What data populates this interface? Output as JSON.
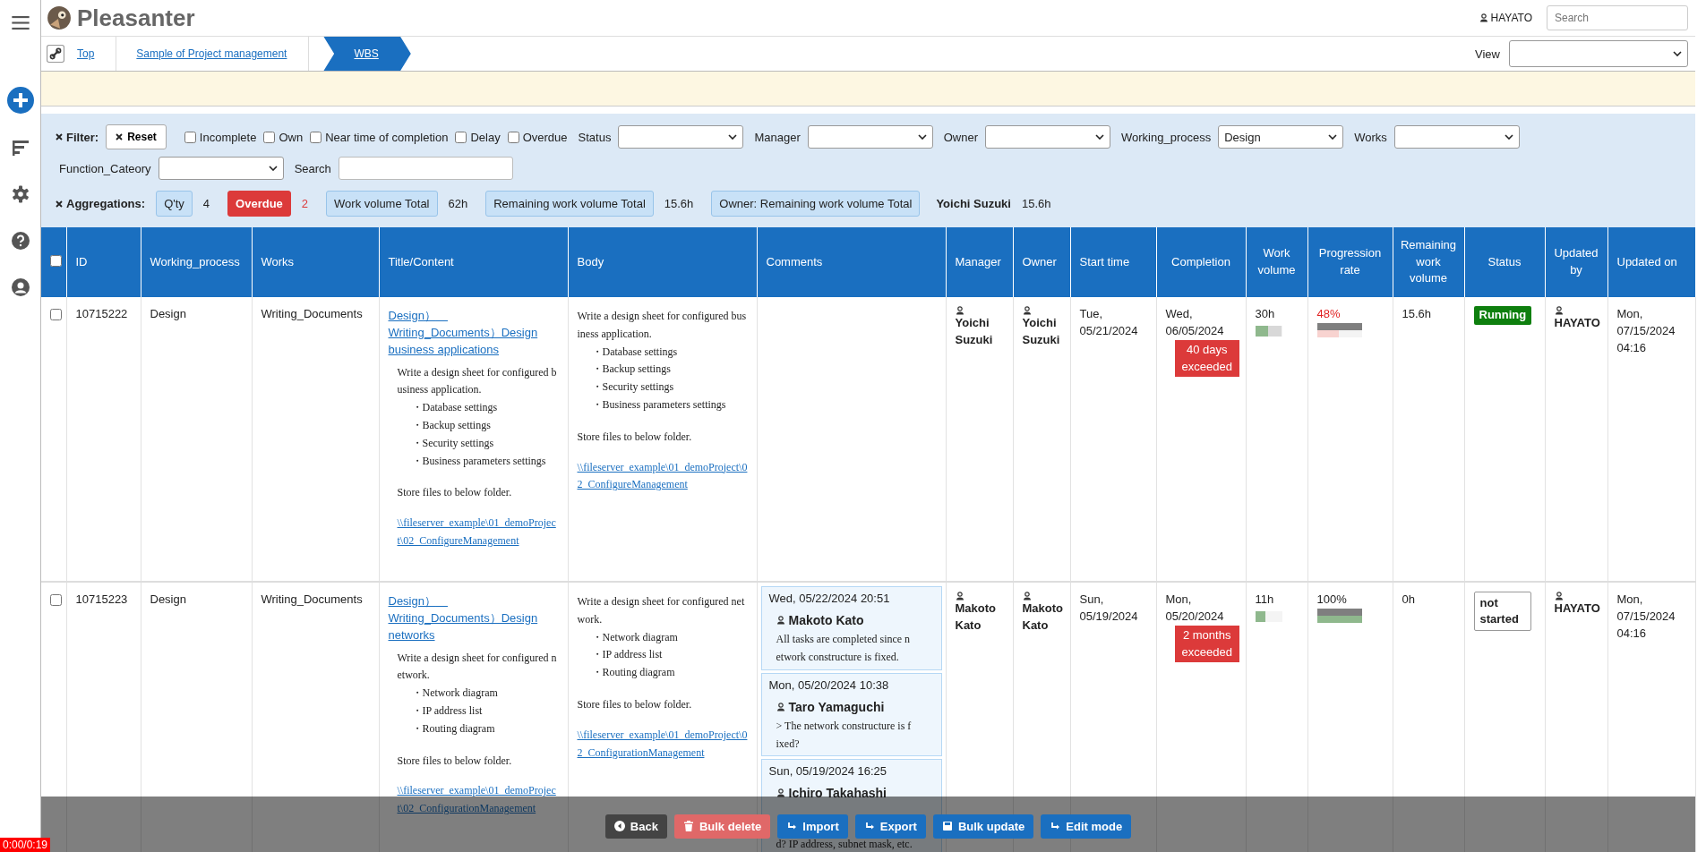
{
  "header": {
    "app_name": "Pleasanter",
    "user": "HAYATO",
    "search": {
      "placeholder": "Search"
    }
  },
  "breadcrumb": [
    {
      "label": "Top",
      "selected": false
    },
    {
      "label": "Sample of Project management",
      "selected": false
    },
    {
      "label": "WBS",
      "selected": true
    }
  ],
  "view": {
    "label": "View"
  },
  "filter": {
    "label": "Filter:",
    "reset": "Reset",
    "checkboxes": [
      {
        "label": "Incomplete",
        "checked": false
      },
      {
        "label": "Own",
        "checked": false
      },
      {
        "label": "Near time of completion",
        "checked": false
      },
      {
        "label": "Delay",
        "checked": false
      },
      {
        "label": "Overdue",
        "checked": false
      }
    ],
    "dropdowns": [
      {
        "label": "Status"
      },
      {
        "label": "Manager"
      },
      {
        "label": "Owner"
      },
      {
        "label": "Working_process",
        "value": "Design"
      },
      {
        "label": "Works"
      },
      {
        "label": "Function_Cateory"
      }
    ],
    "search_label": "Search"
  },
  "aggregations": {
    "label": "Aggregations:",
    "items": [
      {
        "kind": "chip",
        "label": "Q'ty",
        "value": "4"
      },
      {
        "kind": "alert",
        "label": "Overdue",
        "value": "2"
      },
      {
        "kind": "chip",
        "label": "Work volume Total",
        "value": "62h"
      },
      {
        "kind": "chip",
        "label": "Remaining work volume Total",
        "value": "15.6h"
      },
      {
        "kind": "group",
        "label": "Owner: Remaining work volume Total",
        "owner": "Yoichi Suzuki",
        "value": "15.6h"
      }
    ]
  },
  "table": {
    "select_all": {
      "checked": false
    },
    "columns": [
      "ID",
      "Working_process",
      "Works",
      "Title/Content",
      "Body",
      "Comments",
      "Manager",
      "Owner",
      "Start time",
      "Completion",
      "Work volume",
      "Progression rate",
      "Remaining work volume",
      "Status",
      "Updated by",
      "Updated on"
    ],
    "rows": [
      {
        "checked": false,
        "id": "10715222",
        "working_process": "Design",
        "works": "Writing_Documents",
        "title": "Design）　Writing_Documents）Design business applications",
        "title_content": {
          "intro": "Write a design sheet for configured business application.",
          "bullets": [
            "・Database settings",
            "・Backup settings",
            "・Security settings",
            "・Business parameters settings"
          ],
          "note": "Store files to below folder.",
          "link": "\\\\fileserver_example\\01_demoProject\\02_ConfigureManagement"
        },
        "body": {
          "intro": "Write a design sheet for configured business application.",
          "bullets": [
            "・Database settings",
            "・Backup settings",
            "・Security settings",
            "・Business parameters settings"
          ],
          "note": "Store files to below folder.",
          "link": "\\\\fileserver_example\\01_demoProject\\02_ConfigureManagement"
        },
        "comments": [],
        "manager": "Yoichi Suzuki",
        "owner": "Yoichi Suzuki",
        "start_time": "Tue, 05/21/2024",
        "completion": "Wed, 06/05/2024",
        "overdue": "40 days exceeded",
        "work_volume": "30h",
        "work_done": {
          "level": 0.47
        },
        "work_remaining": {
          "level": 0.53
        },
        "progression_rate": "48%",
        "behind": true,
        "elapsed": {
          "level": 1
        },
        "progress": {
          "level": 0.48
        },
        "remaining": "15.6h",
        "status": {
          "label": "Running",
          "kind": "running"
        },
        "updated_by": "HAYATO",
        "updated_on": "Mon, 07/15/2024 04:16"
      },
      {
        "checked": false,
        "id": "10715223",
        "working_process": "Design",
        "works": "Writing_Documents",
        "title": "Design）　Writing_Documents）Design networks",
        "title_content": {
          "intro": "Write a design sheet for configured network.",
          "bullets": [
            "・Network diagram",
            "・IP address list",
            "・Routing diagram"
          ],
          "note": "Store files to below folder.",
          "link": "\\\\fileserver_example\\01_demoProject\\02_ConfigurationManagement"
        },
        "body": {
          "intro": "Write a design sheet for configured network.",
          "bullets": [
            "・Network diagram",
            "・IP address list",
            "・Routing diagram"
          ],
          "note": "Store files to below folder.",
          "link": "\\\\fileserver_example\\01_demoProject\\02_ConfigurationManagement"
        },
        "comments": [
          {
            "date": "Wed, 05/22/2024 20:51",
            "author": "Makoto Kato",
            "text": "All tasks are completed since network constructure is fixed."
          },
          {
            "date": "Mon, 05/20/2024 10:38",
            "author": "Taro Yamaguchi",
            "text": "> The network constructure is fixed?"
          },
          {
            "date": "Sun, 05/19/2024 16:25",
            "author": "Ichiro Takahashi",
            "text": "d? IP address, subnet mask, etc."
          }
        ],
        "manager": "Makoto Kato",
        "owner": "Makoto Kato",
        "start_time": "Sun, 05/19/2024",
        "completion": "Mon, 05/20/2024",
        "overdue": "2 months exceeded",
        "work_volume": "11h",
        "work_done": {
          "level": 0.37
        },
        "progression_rate": "100%",
        "behind": false,
        "elapsed": {
          "level": 1
        },
        "progress": {
          "level": 1
        },
        "remaining": "0h",
        "status": {
          "label": "not started",
          "kind": "not_started"
        },
        "updated_by": "HAYATO",
        "updated_on": "Mon, 07/15/2024 04:16"
      }
    ]
  },
  "actions": [
    {
      "label": "Back",
      "kind": "back"
    },
    {
      "label": "Bulk delete",
      "kind": "delete"
    },
    {
      "label": "Import",
      "kind": "import"
    },
    {
      "label": "Export",
      "kind": "export"
    },
    {
      "label": "Bulk update",
      "kind": "update"
    },
    {
      "label": "Edit mode",
      "kind": "edit"
    }
  ],
  "timer": "0:00/0:19"
}
